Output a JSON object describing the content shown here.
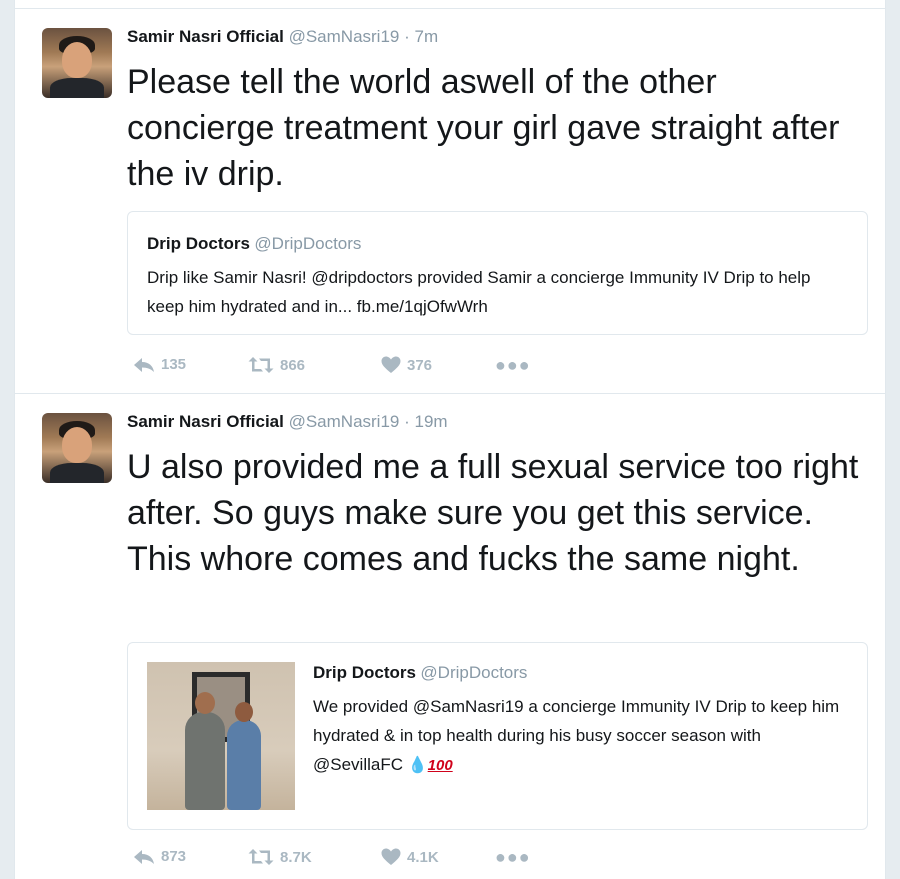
{
  "tweets": [
    {
      "name": "Samir Nasri Official",
      "handle": "@SamNasri19",
      "dot": "·",
      "time": "7m",
      "text": "Please tell the world aswell of the other concierge treatment your girl gave straight after the iv drip.",
      "quote": {
        "name": "Drip Doctors",
        "handle": "@DripDoctors",
        "text": "Drip like Samir Nasri! @dripdoctors provided Samir a concierge Immunity IV Drip to help keep him hydrated and in... fb.me/1qjOfwWrh"
      },
      "stats": {
        "replies": "135",
        "retweets": "866",
        "likes": "376"
      }
    },
    {
      "name": "Samir Nasri Official",
      "handle": "@SamNasri19",
      "dot": "·",
      "time": "19m",
      "text": "U also provided me a full sexual service too right after. So guys make sure you get this service. This whore comes and fucks the same night.",
      "quote": {
        "name": "Drip Doctors",
        "handle": "@DripDoctors",
        "text": "We provided @SamNasri19 a concierge Immunity IV Drip to keep him hydrated & in top health during his busy soccer season with @SevillaFC",
        "emoji_drop": "💧",
        "emoji_100": "100"
      },
      "stats": {
        "replies": "873",
        "retweets": "8.7K",
        "likes": "4.1K"
      }
    }
  ],
  "icons": {
    "reply": "reply-icon",
    "retweet": "retweet-icon",
    "like": "heart-icon",
    "more": "more-icon"
  },
  "colors": {
    "muted": "#8899a6",
    "action": "#aab8c2",
    "border": "#e1e8ed"
  }
}
